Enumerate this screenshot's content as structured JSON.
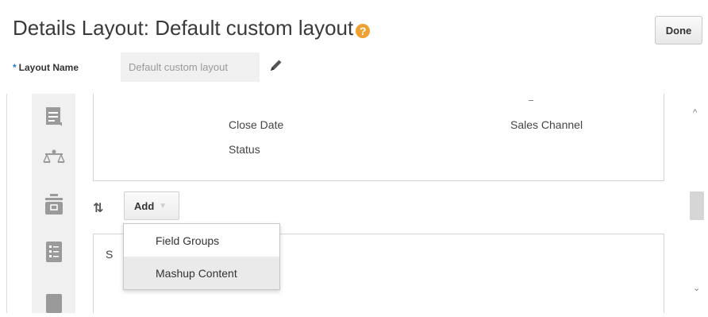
{
  "header": {
    "title": "Details Layout: Default custom layout",
    "help_glyph": "?",
    "done_label": "Done",
    "help_icon_color": "#f0a030"
  },
  "layout_name": {
    "required_marker": "*",
    "label": "Layout Name",
    "value": "Default custom layout"
  },
  "rail": {
    "icons": [
      "document-icon",
      "scales-icon",
      "briefcase-icon",
      "checklist-icon",
      "card-icon"
    ]
  },
  "section1": {
    "fields": [
      "Close Date",
      "Status",
      "Sales Channel"
    ],
    "dash_glyph": "-"
  },
  "toolbar": {
    "sort_glyph": "⇅",
    "add_label": "Add",
    "add_caret": "▼"
  },
  "add_menu": {
    "items": [
      "Field Groups",
      "Mashup Content"
    ]
  },
  "section2": {
    "fragment": "S"
  },
  "scrollbar": {
    "up_glyph": "^",
    "down_glyph": "⌄"
  }
}
